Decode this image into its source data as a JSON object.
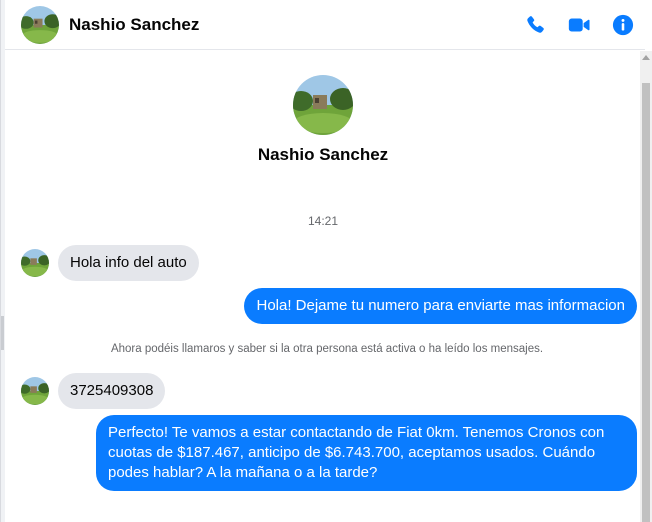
{
  "header": {
    "contact_name": "Nashio Sanchez",
    "actions": [
      {
        "icon": "phone-icon",
        "label": ""
      },
      {
        "icon": "video-camera-icon",
        "label": ""
      },
      {
        "icon": "info-icon",
        "label": ""
      }
    ],
    "accent_color": "#0a7cff"
  },
  "profile": {
    "name": "Nashio Sanchez"
  },
  "conversation": {
    "timestamp": "14:21",
    "messages": [
      {
        "direction": "incoming",
        "text": "Hola info del auto"
      },
      {
        "direction": "outgoing",
        "text": "Hola! Dejame tu numero para enviarte mas informacion"
      },
      {
        "direction": "system",
        "text": "Ahora podéis llamaros y saber si la otra persona está activa o ha leído los mensajes."
      },
      {
        "direction": "incoming",
        "text": "3725409308"
      },
      {
        "direction": "outgoing",
        "text": "Perfecto! Te vamos a estar contactando de Fiat 0km. Tenemos Cronos con cuotas de $187.467, anticipo de $6.743.700, aceptamos usados. Cuándo podes hablar? A la mañana o a la tarde?"
      }
    ]
  }
}
